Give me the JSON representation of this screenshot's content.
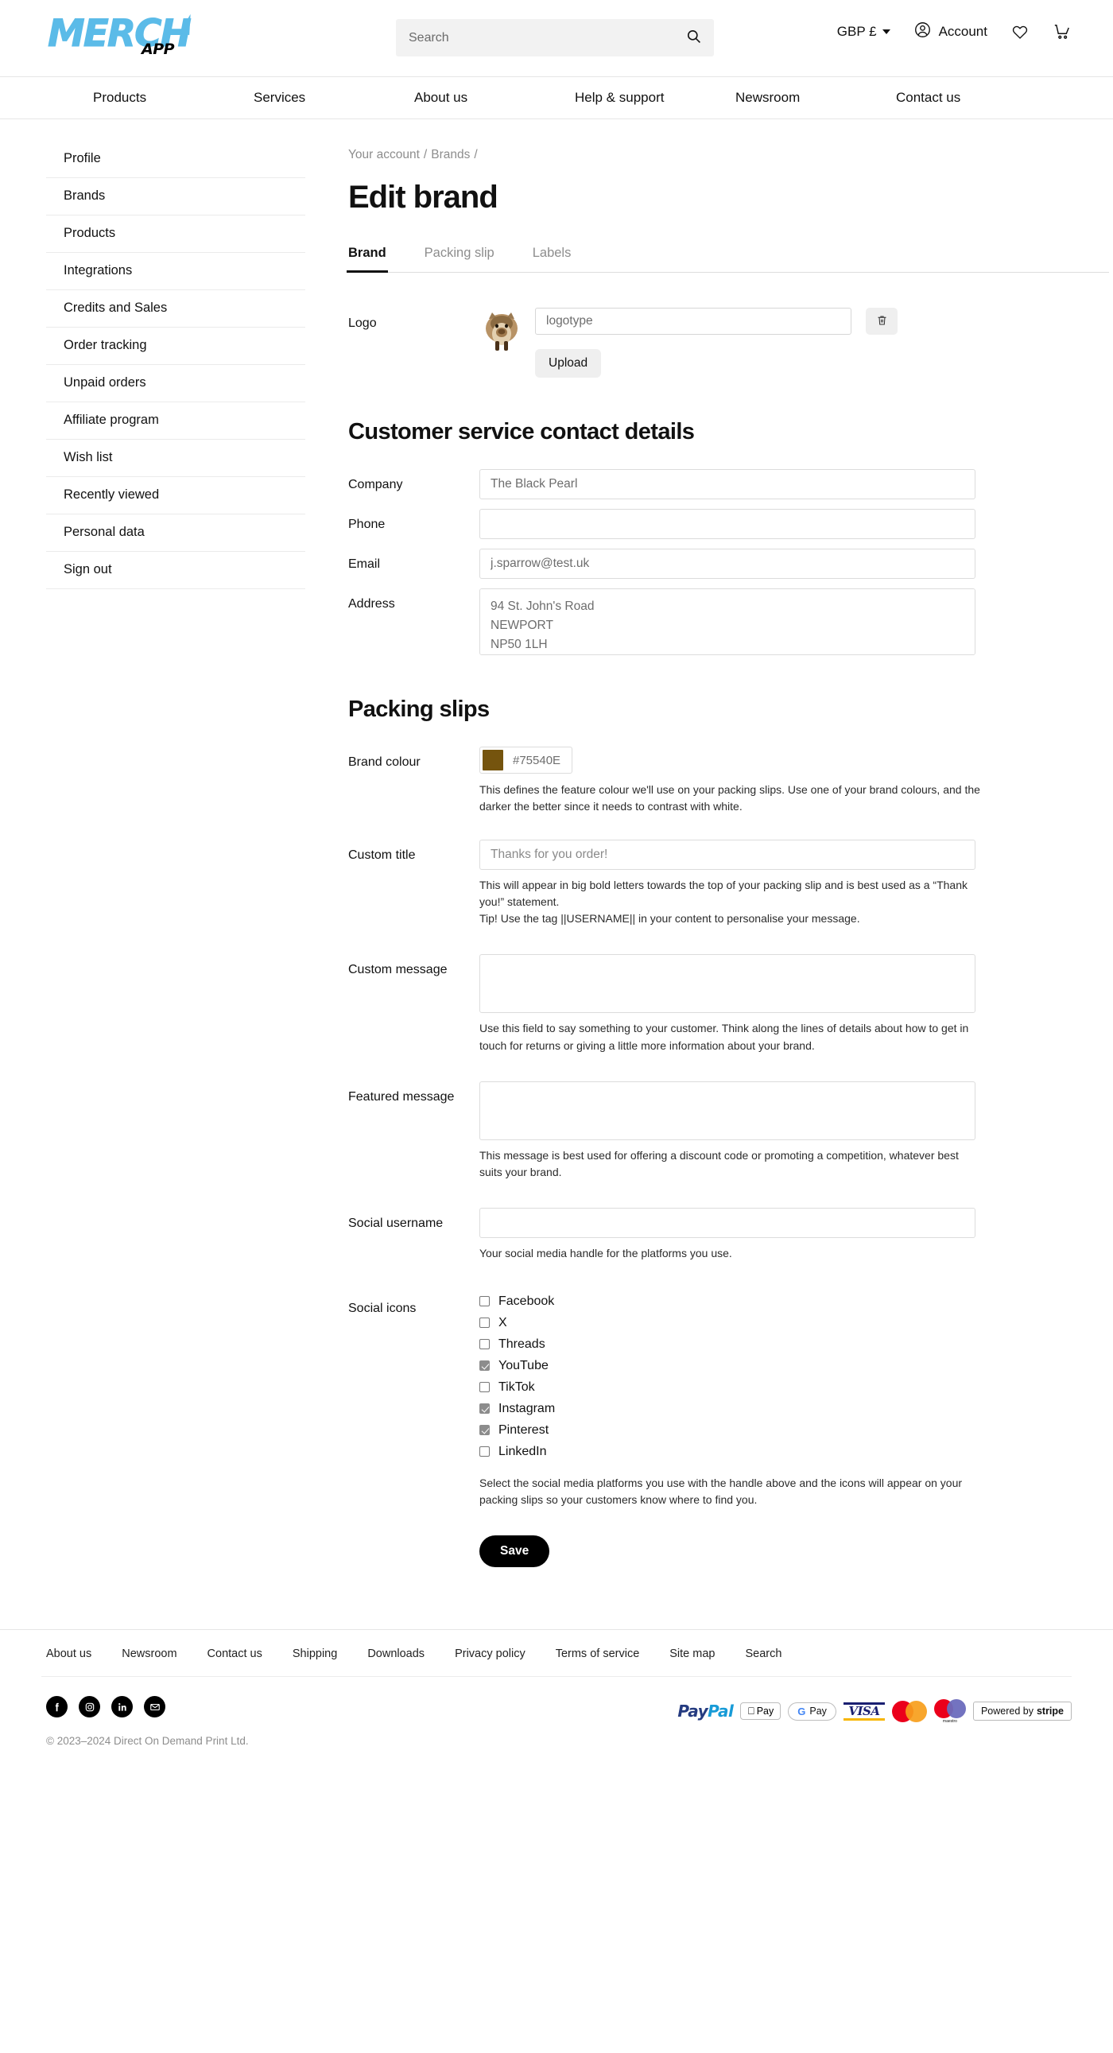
{
  "header": {
    "logo": {
      "main": "MERCH",
      "sub": "APP"
    },
    "search": {
      "placeholder": "Search",
      "value": ""
    },
    "currency": "GBP £",
    "account": "Account",
    "icons": {
      "search": "search-icon",
      "wishlist": "heart-icon",
      "cart": "cart-icon",
      "account": "user-circle-icon"
    }
  },
  "nav": {
    "items": [
      {
        "label": "Products"
      },
      {
        "label": "Services"
      },
      {
        "label": "About us"
      },
      {
        "label": "Help & support"
      },
      {
        "label": "Newsroom"
      },
      {
        "label": "Contact us"
      }
    ]
  },
  "sidebar": {
    "items": [
      {
        "label": "Profile"
      },
      {
        "label": "Brands"
      },
      {
        "label": "Products"
      },
      {
        "label": "Integrations"
      },
      {
        "label": "Credits and Sales"
      },
      {
        "label": "Order tracking"
      },
      {
        "label": "Unpaid orders"
      },
      {
        "label": "Affiliate program"
      },
      {
        "label": "Wish list"
      },
      {
        "label": "Recently viewed"
      },
      {
        "label": "Personal data"
      },
      {
        "label": "Sign out"
      }
    ]
  },
  "breadcrumb": {
    "items": [
      "Your account",
      "Brands"
    ],
    "separator": "/"
  },
  "page_title": "Edit brand",
  "tabs": [
    {
      "label": "Brand",
      "active": true
    },
    {
      "label": "Packing slip",
      "active": false
    },
    {
      "label": "Labels",
      "active": false
    }
  ],
  "logo_section": {
    "label": "Logo",
    "filename_placeholder": "logotype",
    "filename_value": "",
    "delete_icon": "trash-icon",
    "upload_label": "Upload"
  },
  "contact": {
    "heading": "Customer service contact details",
    "fields": [
      {
        "label": "Company",
        "value": "The Black Pearl",
        "placeholder": ""
      },
      {
        "label": "Phone",
        "value": "",
        "placeholder": ""
      },
      {
        "label": "Email",
        "value": "j.sparrow@test.uk",
        "placeholder": ""
      }
    ],
    "address": {
      "label": "Address",
      "value": "94 St. John's Road\nNEWPORT\nNP50 1LH"
    }
  },
  "packing": {
    "heading": "Packing slips",
    "brand_colour": {
      "label": "Brand colour",
      "hex": "#75540E",
      "help": "This defines the feature colour we'll use on your packing slips. Use one of your brand colours, and the darker the better since it needs to contrast with white."
    },
    "custom_title": {
      "label": "Custom title",
      "placeholder": "Thanks for you order!",
      "value": "",
      "help_line1": "This will appear in big bold letters towards the top of your packing slip and is best used as a “Thank you!” statement.",
      "help_line2": "Tip! Use the tag ||USERNAME|| in your content to personalise your message."
    },
    "custom_message": {
      "label": "Custom message",
      "value": "",
      "help": "Use this field to say something to your customer. Think along the lines of details about how to get in touch for returns or giving a little more information about your brand."
    },
    "featured_message": {
      "label": "Featured message",
      "value": "",
      "help": "This message is best used for offering a discount code or promoting a competition, whatever best suits your brand."
    },
    "social_username": {
      "label": "Social username",
      "value": "",
      "help": "Your social media handle for the platforms you use."
    },
    "social_icons": {
      "label": "Social icons",
      "options": [
        {
          "label": "Facebook",
          "checked": false
        },
        {
          "label": "X",
          "checked": false
        },
        {
          "label": "Threads",
          "checked": false
        },
        {
          "label": "YouTube",
          "checked": true
        },
        {
          "label": "TikTok",
          "checked": false
        },
        {
          "label": "Instagram",
          "checked": true
        },
        {
          "label": "Pinterest",
          "checked": true
        },
        {
          "label": "LinkedIn",
          "checked": false
        }
      ],
      "help": "Select the social media platforms you use with the handle above and the icons will appear on your packing slips so your customers know where to find you."
    },
    "save_label": "Save"
  },
  "footer": {
    "links": [
      {
        "label": "About us"
      },
      {
        "label": "Newsroom"
      },
      {
        "label": "Contact us"
      },
      {
        "label": "Shipping"
      },
      {
        "label": "Downloads"
      },
      {
        "label": "Privacy policy"
      },
      {
        "label": "Terms of service"
      },
      {
        "label": "Site map"
      },
      {
        "label": "Search"
      }
    ],
    "social": [
      {
        "name": "facebook-icon",
        "glyph": "f"
      },
      {
        "name": "instagram-icon",
        "glyph": "◎"
      },
      {
        "name": "linkedin-icon",
        "glyph": "in"
      },
      {
        "name": "email-icon",
        "glyph": "✉"
      }
    ],
    "payments": [
      {
        "name": "paypal",
        "label": "PayPal"
      },
      {
        "name": "apple-pay",
        "label": "Pay"
      },
      {
        "name": "google-pay",
        "label": "Pay"
      },
      {
        "name": "visa",
        "label": "VISA"
      },
      {
        "name": "mastercard",
        "label": ""
      },
      {
        "name": "maestro",
        "label": "maestro"
      },
      {
        "name": "stripe",
        "label_pre": "Powered by",
        "label_main": "stripe"
      }
    ],
    "copyright": "© 2023–2024 Direct On Demand Print Ltd."
  }
}
